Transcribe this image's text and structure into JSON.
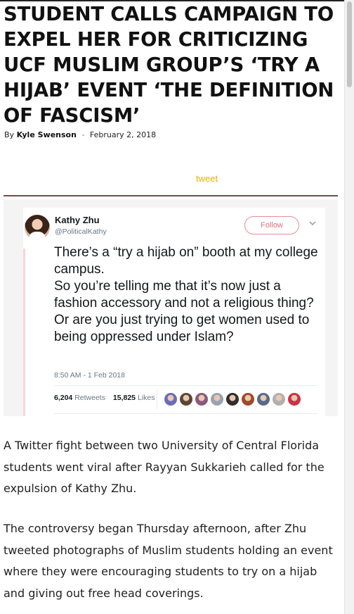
{
  "article": {
    "headline": "STUDENT CALLS CAMPAIGN TO EXPEL HER FOR CRITICIZING UCF MUSLIM GROUP’S ‘TRY A HIJAB’ EVENT ‘THE DEFINITION OF FASCISM’",
    "byline_prefix": "By",
    "author": "Kyle Swenson",
    "separator": "-",
    "date": "February 2, 2018",
    "embed_link": "tweet",
    "paragraphs": [
      "A Twitter fight between two University of Central Florida students went viral after Rayyan Sukkarieh called for the expulsion of Kathy Zhu.",
      "The controversy began Thursday afternoon, after Zhu tweeted photographs of Muslim students holding an event where they were encouraging students to try on a hijab and giving out free head coverings."
    ]
  },
  "tweet": {
    "name": "Kathy Zhu",
    "handle": "@PoliticalKathy",
    "follow_label": "Follow",
    "text": "There’s a “try a hijab on” booth at my college campus.\nSo you’re telling me that it’s now just a fashion accessory and not a religious thing?\nOr are you just trying to get women used to being oppressed under Islam?",
    "timestamp": "8:50 AM - 1 Feb 2018",
    "retweets_count": "6,204",
    "retweets_label": "Retweets",
    "likes_count": "15,825",
    "likes_label": "Likes",
    "liker_avatar_colors": [
      "#6b6bb8",
      "#5a4636",
      "#8a5a7a",
      "#9aa4b0",
      "#2f2f2f",
      "#a04a2a",
      "#556a8a",
      "#b0b0b0",
      "#cc3344"
    ]
  },
  "icons": {
    "chevron": "chevron-down-icon",
    "avatar": "profile-avatar"
  },
  "colors": {
    "tweet_link": "#e2b100",
    "follow_accent": "#e26c80",
    "embed_rule": "#7a4a4a"
  }
}
